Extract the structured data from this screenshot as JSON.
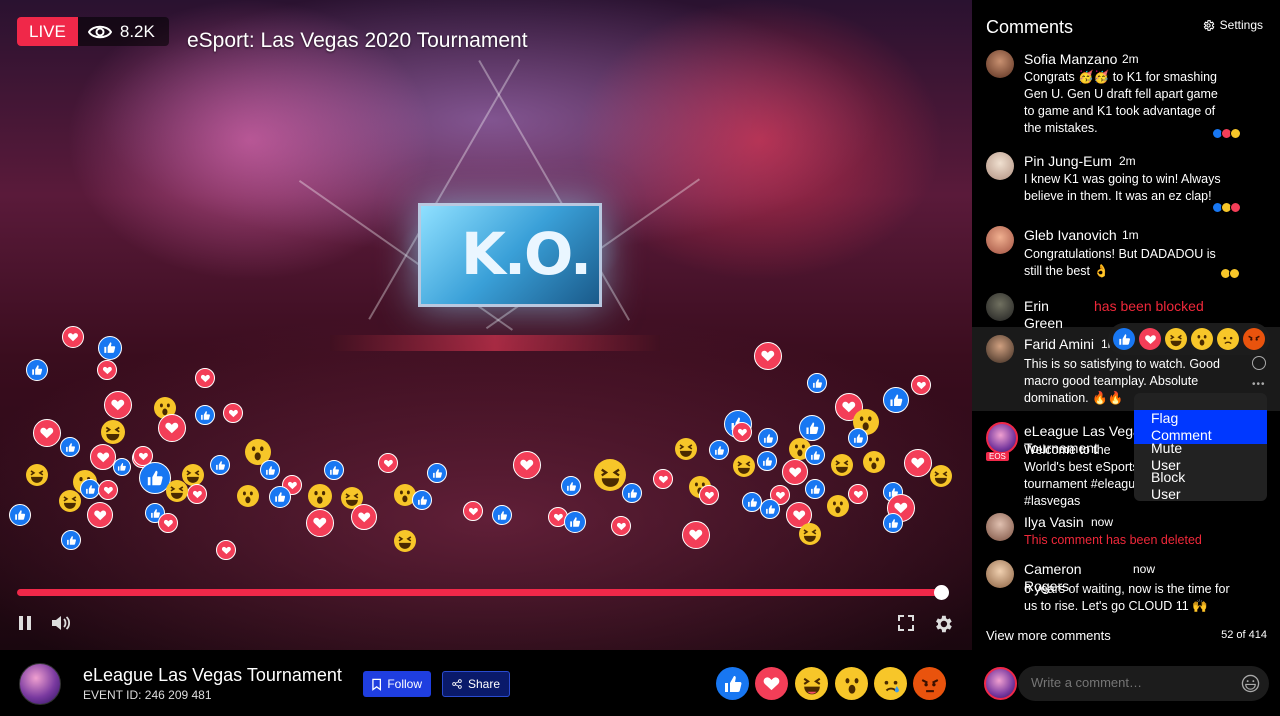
{
  "video": {
    "live_label": "LIVE",
    "viewers": "8.2K",
    "title": "eSport: Las Vegas 2020 Tournament",
    "screen_text": "K.O.",
    "progress": 1.0
  },
  "event": {
    "title": "eLeague Las Vegas Tournament",
    "id_text": "EVENT  ID: 246 209 481",
    "follow_label": "Follow",
    "share_label": "Share"
  },
  "comments_panel": {
    "title": "Comments",
    "settings_label": "Settings",
    "comments": [
      {
        "name": "Sofia Manzano",
        "time": "2m",
        "text": "Congrats 🥳🥳 to K1 for smashing Gen U. Gen U draft fell apart game to game and K1 took advantage of the mistakes."
      },
      {
        "name": "Pin Jung-Eum",
        "time": "2m",
        "text": "I knew K1 was going to win! Always believe in them. It was an ez clap!"
      },
      {
        "name": "Gleb Ivanovich",
        "time": "1m",
        "text": "Congratulations! But DADADOU is still the best 👌"
      },
      {
        "name": "Erin Green",
        "time": "",
        "text": "has been blocked"
      },
      {
        "name": "Farid Amini",
        "time": "1m",
        "text": "This is so satisfying to watch. Good macro good teamplay. Absolute domination. 🔥🔥"
      },
      {
        "name": "eLeague Las Vegas Tournament",
        "time": "",
        "text": "Welcome to the World's best eSports tournament #eleague #lasvegas"
      },
      {
        "name": "Ilya Vasin",
        "time": "now",
        "text": "This comment has been deleted"
      },
      {
        "name": "Cameron Rogers",
        "time": "now",
        "text": "6 years of waiting, now is the time for us to rise. Let's go CLOUD 11 🙌"
      }
    ],
    "context_menu": [
      "Flag Comment",
      "Mute User",
      "Block User"
    ],
    "view_more": "View more comments",
    "count": "52 of 414",
    "write_placeholder": "Write a comment…",
    "owner_tag": "EOS"
  },
  "colors": {
    "live": "#f02849",
    "like": "#1877f2",
    "love": "#f33e58",
    "emoji": "#f7c629",
    "angry": "#e9530d",
    "menu_active": "#0038ff"
  }
}
